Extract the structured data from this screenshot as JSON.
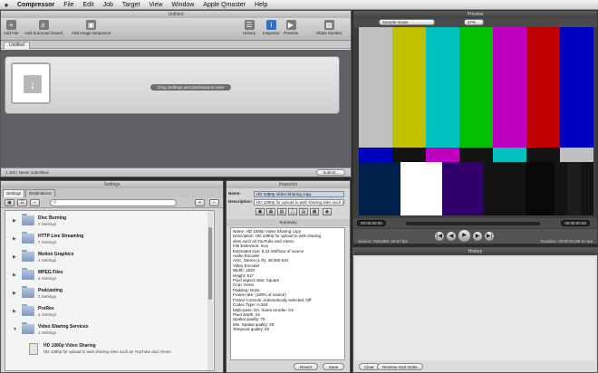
{
  "menubar": {
    "apple": "",
    "items": [
      "Compressor",
      "File",
      "Edit",
      "Job",
      "Target",
      "View",
      "Window",
      "Apple Qmaster",
      "Help"
    ]
  },
  "main": {
    "title": "Untitled",
    "toolbar": {
      "add_file": "Add File",
      "add_surround": "Add Surround Sound",
      "add_image_seq": "Add Image Sequence",
      "history": "History",
      "inspector": "Inspector",
      "preview": "Preview",
      "share_monitor": "Share Monitor"
    },
    "tab": "Untitled",
    "drop_label": "Drag Settings and Destinations Here",
    "status": "1 Job  |  Never submitted",
    "submit": "Submit..."
  },
  "preview": {
    "title": "Preview",
    "source_popup": "Sample movie",
    "zoom_popup": "47%",
    "timecode_left": "00:00:00;00",
    "timecode_right": "00:00:00;00",
    "source_info": "Source: 720x480, 29.97 fps",
    "duration_info": "Duration: 00:00:01;00 In~out",
    "colors": {
      "top": [
        "#c0c0c0",
        "#c0c000",
        "#00c0c0",
        "#00c000",
        "#c000c0",
        "#c00000",
        "#0000c0"
      ],
      "mid": [
        "#0000c0",
        "#131313",
        "#c000c0",
        "#131313",
        "#00c0c0",
        "#131313",
        "#c0c0c0"
      ],
      "bottom": [
        "#00214c",
        "#ffffff",
        "#32006a",
        "#131313",
        "#090909",
        "#131313",
        "#1d1d1d",
        "#131313"
      ]
    }
  },
  "settings": {
    "title": "Settings",
    "tabs": [
      "Settings",
      "Destinations"
    ],
    "groups": [
      {
        "name": "Disc Burning",
        "count": "2 Settings"
      },
      {
        "name": "HTTP Live Streaming",
        "count": "7 Settings"
      },
      {
        "name": "Motion Graphics",
        "count": "4 Settings"
      },
      {
        "name": "MPEG Files",
        "count": "4 Settings"
      },
      {
        "name": "Podcasting",
        "count": "3 Settings"
      },
      {
        "name": "ProRes",
        "count": "4 Settings"
      },
      {
        "name": "Video Sharing Services",
        "count": "1 Settings"
      }
    ],
    "item": {
      "name": "HD 1080p Video Sharing",
      "desc": "HD 1080p for upload to web sharing sites such as YouTube and Vimeo"
    }
  },
  "inspector": {
    "title": "Inspector",
    "name_label": "Name:",
    "name_value": "HD 1080p Video Sharing copy",
    "desc_label": "Description:",
    "desc_value": "HD 1080p for upload to web sharing sites such as YouTube and Vimeo",
    "summary_label": "Summary",
    "summary": [
      "Name: HD 1080p Video Sharing copy",
      "Description: HD 1080p for upload to web sharing",
      "sites such as YouTube and Vimeo",
      "File Extension: mov",
      "Estimated size: 8.22 GB/hour of source",
      "Audio Encoder",
      "    AAC, Stereo (L R), 48.000 kHz",
      "Video Encoder",
      "    Width: 1920",
      "    Height: 817",
      "    Pixel aspect ratio: Square",
      "    Crop: None",
      "    Padding: None",
      "    Frame rate: (100% of source)",
      "    Frame Controls: Automatically selected: Off",
      "    Codec Type: H.264",
      "    Multi-pass: On, frame reorder: On",
      "    Pixel depth: 24",
      "    Spatial quality: 75",
      "    Min. Spatial quality: 25",
      "    Temporal quality: 50"
    ],
    "revert": "Revert",
    "save": "Save"
  },
  "history": {
    "title": "History",
    "clear": "Clear",
    "reverse": "Reverse Sort Order"
  }
}
